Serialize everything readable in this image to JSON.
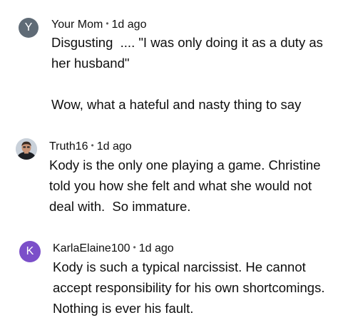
{
  "comments": [
    {
      "avatar_letter": "Y",
      "avatar_color": "#5f6b76",
      "author": "Your Mom",
      "separator": "•",
      "time": "1d ago",
      "text": "Disgusting  .... \"I was only doing it as a duty as her husband\"\n\nWow, what a hateful and nasty thing to say"
    },
    {
      "avatar_letter": "",
      "avatar_icon": "profile-photo",
      "author": "Truth16",
      "separator": "•",
      "time": "1d ago",
      "text": "Kody is the only one playing a game. Christine told you how she felt and what she would not deal with.  So immature."
    },
    {
      "avatar_letter": "K",
      "avatar_color": "#7b4fc9",
      "author": "KarlaElaine100",
      "separator": "•",
      "time": "1d ago",
      "text": "Kody is such a typical narcissist. He cannot accept responsibility for his own shortcomings. Nothing is ever his fault."
    }
  ]
}
